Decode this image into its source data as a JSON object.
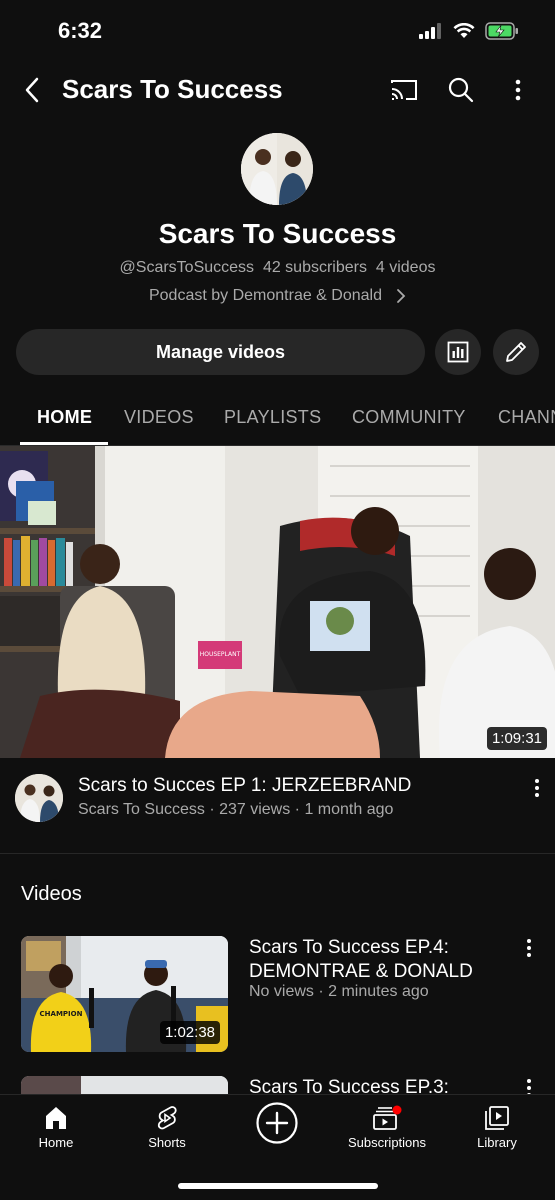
{
  "status": {
    "time": "6:32"
  },
  "header": {
    "title": "Scars To Success"
  },
  "channel": {
    "name": "Scars To Success",
    "handle": "@ScarsToSuccess",
    "subscribers": "42 subscribers",
    "videos": "4 videos",
    "description": "Podcast by Demontrae & Donald"
  },
  "actions": {
    "manage_label": "Manage videos"
  },
  "tabs": [
    {
      "label": "HOME",
      "active": true
    },
    {
      "label": "VIDEOS"
    },
    {
      "label": "PLAYLISTS"
    },
    {
      "label": "COMMUNITY"
    },
    {
      "label": "CHANNELS"
    }
  ],
  "featured": {
    "duration": "1:09:31",
    "title": "Scars to Succes EP 1: JERZEEBRAND",
    "channel": "Scars To Success",
    "views": "237 views",
    "age": "1 month ago",
    "meta": "Scars To Success · 237 views · 1 month ago",
    "sign_text": "HOUSEPLANT"
  },
  "videos_section": {
    "title": "Videos"
  },
  "videos": [
    {
      "title": "Scars To Success EP.4: DEMONTRAE & DONALD",
      "meta": "No views · 2 minutes ago",
      "duration": "1:02:38",
      "shirt_text": "CHAMPION"
    },
    {
      "title": "Scars To Success EP.3:",
      "meta": "",
      "duration": ""
    }
  ],
  "bottom_nav": [
    {
      "label": "Home",
      "icon": "home-icon"
    },
    {
      "label": "Shorts",
      "icon": "shorts-icon"
    },
    {
      "label": "",
      "icon": "create-icon"
    },
    {
      "label": "Subscriptions",
      "icon": "subscriptions-icon"
    },
    {
      "label": "Library",
      "icon": "library-icon"
    }
  ],
  "colors": {
    "background": "#0f0f0f",
    "button_bg": "#272727",
    "secondary_text": "#aaaaaa",
    "notification_dot": "#ff0000",
    "battery_green": "#4cd964"
  }
}
